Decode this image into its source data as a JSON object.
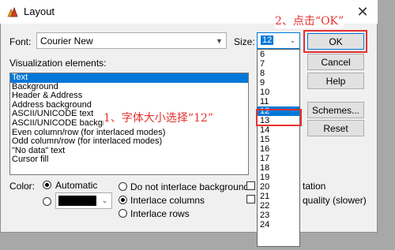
{
  "window": {
    "title": "Layout",
    "close_glyph": "✕"
  },
  "font": {
    "label": "Font:",
    "value": "Courier New"
  },
  "size": {
    "label": "Size:",
    "value": "12",
    "options": [
      "6",
      "7",
      "8",
      "9",
      "10",
      "11",
      "12",
      "13",
      "14",
      "15",
      "16",
      "17",
      "18",
      "19",
      "20",
      "21",
      "22",
      "23",
      "24"
    ],
    "selected": "12"
  },
  "buttons": {
    "ok": "OK",
    "cancel": "Cancel",
    "help": "Help",
    "schemes": "Schemes...",
    "reset": "Reset"
  },
  "visualization": {
    "label": "Visualization elements:",
    "items": [
      "Text",
      "Background",
      "Header & Address",
      "Address background",
      "ASCII/UNICODE text",
      "ASCII/UNICODE background",
      "Even column/row (for interlaced modes)",
      "Odd column/row (for interlaced modes)",
      "\"No data\" text",
      "Cursor fill"
    ],
    "selected_index": 0
  },
  "color": {
    "label": "Color:",
    "automatic": "Automatic"
  },
  "interlace": {
    "none": "Do not interlace background",
    "columns": "Interlace columns",
    "rows": "Interlace rows",
    "selected": "columns"
  },
  "right_options": {
    "partial_1": "tation",
    "partial_2": "quality (slower)"
  },
  "annotations": {
    "step1": "1、字体大小选择“12”",
    "step2": "2、点击“OK”"
  },
  "colors": {
    "accent": "#0078d7",
    "annotation_red": "#e5312f"
  }
}
